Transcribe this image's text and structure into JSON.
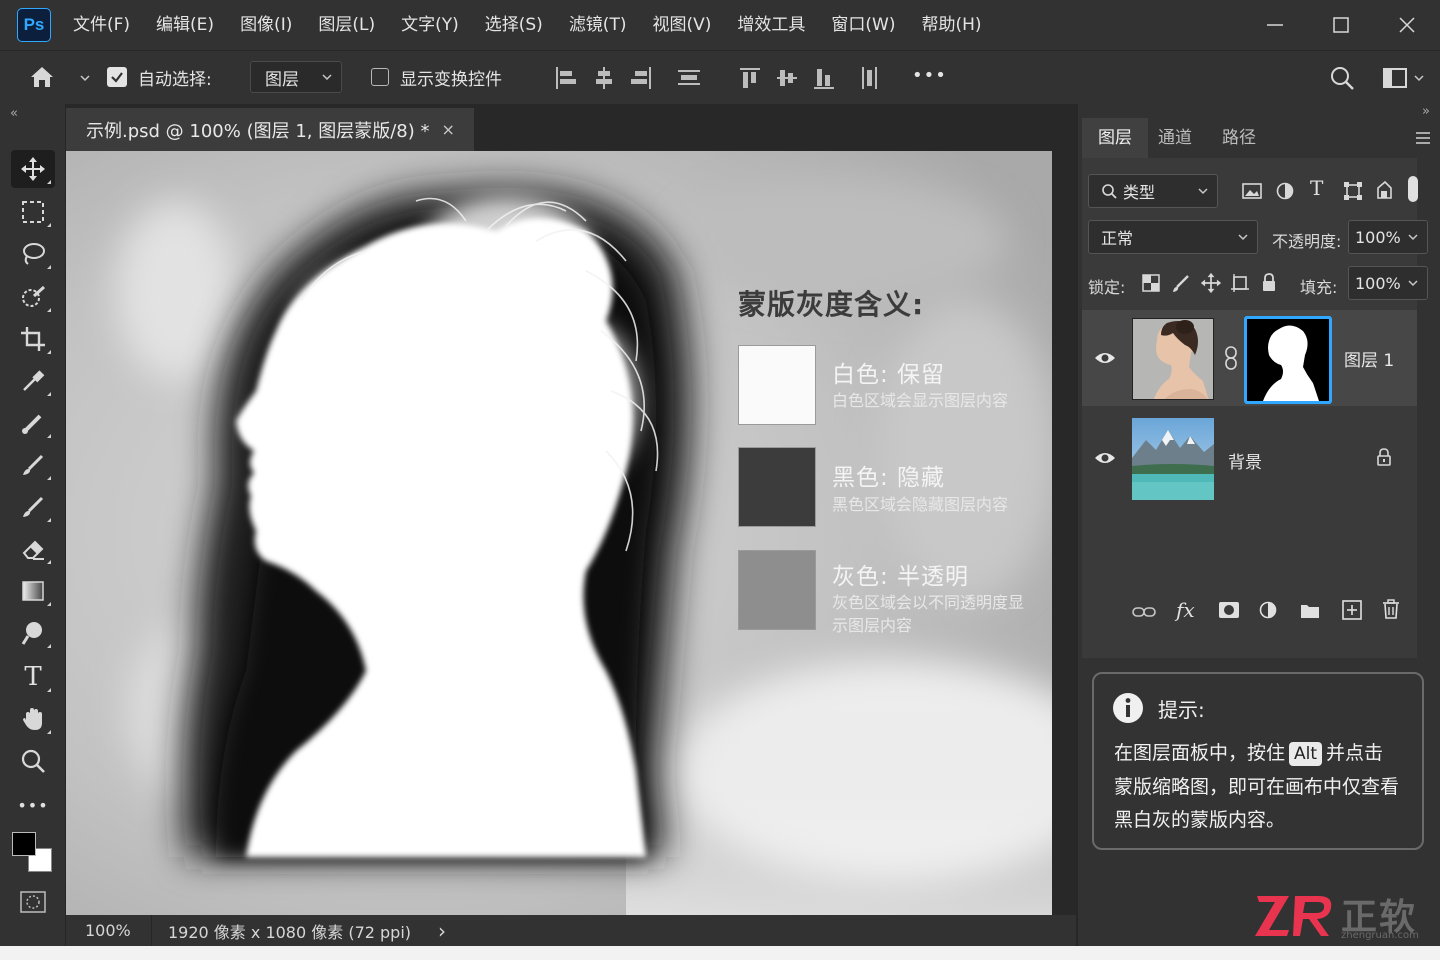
{
  "app": {
    "logo": "Ps"
  },
  "menu": [
    "文件(F)",
    "编辑(E)",
    "图像(I)",
    "图层(L)",
    "文字(Y)",
    "选择(S)",
    "滤镜(T)",
    "视图(V)",
    "增效工具",
    "窗口(W)",
    "帮助(H)"
  ],
  "options": {
    "auto_select_label": "自动选择:",
    "auto_select_checked": true,
    "auto_select_value": "图层",
    "show_transform_label": "显示变换控件",
    "show_transform_checked": false,
    "more": "•••"
  },
  "document": {
    "tab_title": "示例.psd @ 100% (图层 1, 图层蒙版/8) *",
    "tab_close": "×",
    "zoom": "100%",
    "size_info": "1920 像素 x 1080 像素 (72 ppi)",
    "status_arrow": "›"
  },
  "canvas_legend": {
    "title": "蒙版灰度含义:",
    "items": [
      {
        "heading": "白色: 保留",
        "desc": "白色区域会显示图层内容",
        "swatch_color": "#fafafa"
      },
      {
        "heading": "黑色: 隐藏",
        "desc": "黑色区域会隐藏图层内容",
        "swatch_color": "#3c3c3c"
      },
      {
        "heading": "灰色: 半透明",
        "desc": "灰色区域会以不同透明度显示图层内容",
        "swatch_color": "#8e8e8e"
      }
    ]
  },
  "toolbar": {
    "tools": [
      "move-tool",
      "marquee-tool",
      "lasso-tool",
      "quick-select-tool",
      "crop-tool",
      "eyedropper-tool",
      "healing-brush-tool",
      "brush-tool",
      "clone-stamp-tool",
      "eraser-tool",
      "gradient-tool",
      "dodge-tool",
      "type-tool",
      "hand-tool",
      "zoom-tool",
      "more-tools"
    ],
    "type_glyph": "T",
    "more_glyph": "•••",
    "foreground_color": "#000000",
    "background_color": "#ffffff"
  },
  "layers_panel": {
    "tabs": [
      "图层",
      "通道",
      "路径"
    ],
    "active_tab": "图层",
    "filter_label": "类型",
    "filter_type_glyph": "T",
    "blend_mode": "正常",
    "opacity_label": "不透明度:",
    "opacity_value": "100%",
    "lock_label": "锁定:",
    "fill_label": "填充:",
    "fill_value": "100%",
    "fx_label": "fx",
    "layers": [
      {
        "name": "图层 1",
        "visible": true,
        "has_mask": true,
        "selected": true
      },
      {
        "name": "背景",
        "visible": true,
        "locked": true,
        "selected": false
      }
    ]
  },
  "tip": {
    "title": "提示:",
    "line1_before": "在图层面板中，按住",
    "key": "Alt",
    "line1_after": "并点击",
    "line2": "蒙版缩略图，即可在画布中仅查看",
    "line3": "黑白灰的蒙版内容。"
  },
  "brand": {
    "text": "正软",
    "url_text": "zhengruan.com"
  },
  "colors": {
    "accent": "#31a8ff",
    "brand_red": "#e8344e",
    "panel_bg": "#323232"
  }
}
